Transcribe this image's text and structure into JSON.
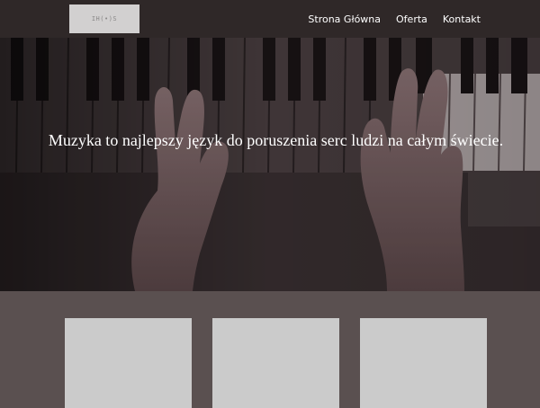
{
  "header": {
    "logo_text": "IH(•)S",
    "nav": [
      {
        "label": "Strona Główna"
      },
      {
        "label": "Oferta"
      },
      {
        "label": "Kontakt"
      }
    ]
  },
  "hero": {
    "tagline": "Muzyka to najlepszy język do poruszenia serc ludzi na całym świecie.",
    "image": "hands-playing-piano"
  },
  "cards": [
    {
      "image": "placeholder"
    },
    {
      "image": "placeholder"
    },
    {
      "image": "placeholder"
    }
  ],
  "colors": {
    "navbar": "#2f2828",
    "page_background": "#5a5050",
    "card_placeholder": "#cbcbcb",
    "logo_placeholder": "#d2d0d0",
    "text": "#ffffff"
  }
}
